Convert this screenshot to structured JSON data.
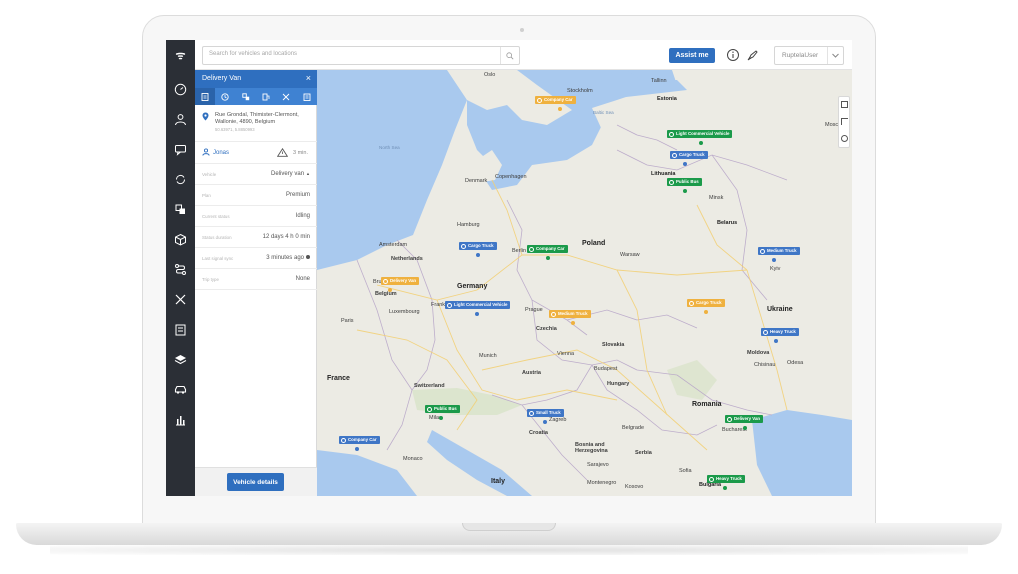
{
  "topbar": {
    "search_placeholder": "Search for vehicles and locations",
    "assist_label": "Assist me",
    "user_name": "RuptelaUser"
  },
  "panel": {
    "title": "Delivery Van",
    "address_line": "Rue Grondal, Thimister-Clermont, Wallonie, 4890, Belgium",
    "address_coords": "50.63971, 5.8850993",
    "driver_name": "Jonas",
    "driver_time": "3 min.",
    "rows": [
      {
        "label": "Vehicle",
        "value": "Delivery van"
      },
      {
        "label": "Plan",
        "value": "Premium"
      },
      {
        "label": "Current status",
        "value": "Idling"
      },
      {
        "label": "Status duration",
        "value": "12 days 4 h 0 min"
      },
      {
        "label": "Last signal sync",
        "value": "3 minutes ago"
      },
      {
        "label": "Trip type",
        "value": "None"
      }
    ],
    "details_button": "Vehicle details"
  },
  "map": {
    "labels": {
      "oslo": "Oslo",
      "stockholm": "Stockholm",
      "tallinn": "Tallinn",
      "estonia": "Estonia",
      "moscow": "Mosco...",
      "baltic_sea": "Baltic Sea",
      "north_sea": "North Sea",
      "denmark": "Denmark",
      "copenhagen": "Copenhagen",
      "lithuania": "Lithuania",
      "minsk": "Minsk",
      "belarus": "Belarus",
      "hamburg": "Hamburg",
      "amsterdam": "Amsterdam",
      "netherlands": "Netherlands",
      "berlin": "Berlin",
      "poland": "Poland",
      "warsaw": "Warsaw",
      "germany": "Germany",
      "belgium": "Belgium",
      "luxembourg": "Luxembourg",
      "frankfurt": "Frank...",
      "prague": "Prague",
      "czechia": "Czechia",
      "kyiv": "Kyiv",
      "ukraine": "Ukraine",
      "paris": "Paris",
      "france": "France",
      "munich": "Munich",
      "vienna": "Vienna",
      "slovakia": "Slovakia",
      "austria": "Austria",
      "budapest": "Budapest",
      "hungary": "Hungary",
      "switzerland": "Switzerland",
      "moldova": "Moldova",
      "odesa": "Odesa",
      "chisinau": "Chisinau",
      "romania": "Romania",
      "bucharest": "Bucharest",
      "croatia": "Croatia",
      "bosnia": "Bosnia and Herzegovina",
      "serbia": "Serbia",
      "sarajevo": "Sarajevo",
      "monaco": "Monaco",
      "italy": "Italy",
      "montenegro": "Montenegro",
      "kosovo": "Kosovo",
      "bulgaria": "Bulgaria",
      "sofia": "Sofia",
      "brussels": "Bru...",
      "zagreb": "Zagreb",
      "milan": "Milan",
      "belgrade": "Belgrade"
    },
    "markers": [
      {
        "label": "Company Car",
        "color": "orange"
      },
      {
        "label": "Light Commercial Vehicle",
        "color": "green"
      },
      {
        "label": "Cargo Truck",
        "color": "blue"
      },
      {
        "label": "Public Bus",
        "color": "green"
      },
      {
        "label": "Cargo Truck",
        "color": "blue"
      },
      {
        "label": "Company Car",
        "color": "green"
      },
      {
        "label": "Medium Truck",
        "color": "blue"
      },
      {
        "label": "Delivery Van",
        "color": "orange"
      },
      {
        "label": "Light Commercial Vehicle",
        "color": "blue"
      },
      {
        "label": "Medium Truck",
        "color": "orange"
      },
      {
        "label": "Cargo Truck",
        "color": "orange"
      },
      {
        "label": "Heavy Truck",
        "color": "blue"
      },
      {
        "label": "Public Bus",
        "color": "green"
      },
      {
        "label": "Small Truck",
        "color": "blue"
      },
      {
        "label": "Delivery Van",
        "color": "green"
      },
      {
        "label": "Company Car",
        "color": "blue"
      },
      {
        "label": "Heavy Truck",
        "color": "green"
      }
    ]
  },
  "colors": {
    "brand_blue": "#2f6fbf",
    "rail_dark": "#2b2f36",
    "marker_blue": "#3f76c6",
    "marker_green": "#1b9a4a",
    "marker_orange": "#efb13f"
  },
  "icons": {
    "rail": [
      "dashboard-icon",
      "user-icon",
      "chat-icon",
      "refresh-icon",
      "copy-icon",
      "box-icon",
      "route-icon",
      "tools-icon",
      "checklist-icon",
      "layers-icon",
      "car-icon",
      "bar-chart-icon"
    ]
  }
}
